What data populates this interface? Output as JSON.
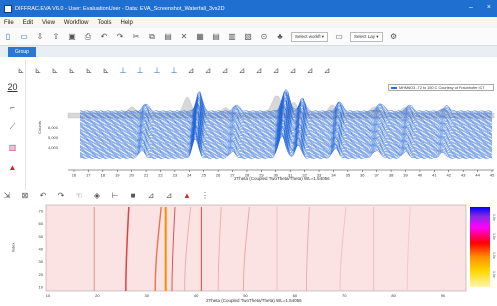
{
  "titlebar": {
    "title": "DIFFRAC.EVA V6.0 - User: EvaluationUser - Data: EVA_Screenshot_Waterfall_3vs2D",
    "minimize": "–",
    "close": "×"
  },
  "menu": [
    "File",
    "Edit",
    "View",
    "Workflow",
    "Tools",
    "Help"
  ],
  "toolbar": {
    "select_workflow": "Select workfl",
    "select_layout": "Select Lay"
  },
  "tabs": {
    "active": "Group"
  },
  "left_panel": {
    "zoom_value": "20"
  },
  "waterfall": {
    "legend": "MHM6O3 -T2 to 150 C Courtesy of Fraunhofer ICT",
    "ylabel": "Counts",
    "yticks": [
      "6,000",
      "5,000",
      "4,000"
    ],
    "xticks": [
      "16",
      "17",
      "18",
      "19",
      "20",
      "21",
      "22",
      "23",
      "24",
      "25",
      "26",
      "27",
      "28",
      "29",
      "30",
      "31",
      "32",
      "33",
      "34",
      "35",
      "36",
      "37",
      "38",
      "39",
      "40",
      "41",
      "42",
      "43",
      "44",
      "45"
    ],
    "xlabel": "2Theta (Coupled TwoTheta/Theta) WL=1.54056",
    "colors": {
      "trace": "#1f63d6",
      "reference": "#b8b8b8"
    }
  },
  "map2d": {
    "ylabel": "Index",
    "yticks": [
      "70",
      "60",
      "50",
      "40",
      "30",
      "20",
      "10"
    ],
    "xticks": [
      "10",
      "20",
      "30",
      "40",
      "50",
      "60",
      "70",
      "80",
      "90"
    ],
    "xlabel": "2Theta (Coupled TwoTheta/Theta) WL=1.54056",
    "colorbar_labels": [
      "1.0e",
      "1.0e",
      "1.0e",
      "1.0e"
    ]
  }
}
